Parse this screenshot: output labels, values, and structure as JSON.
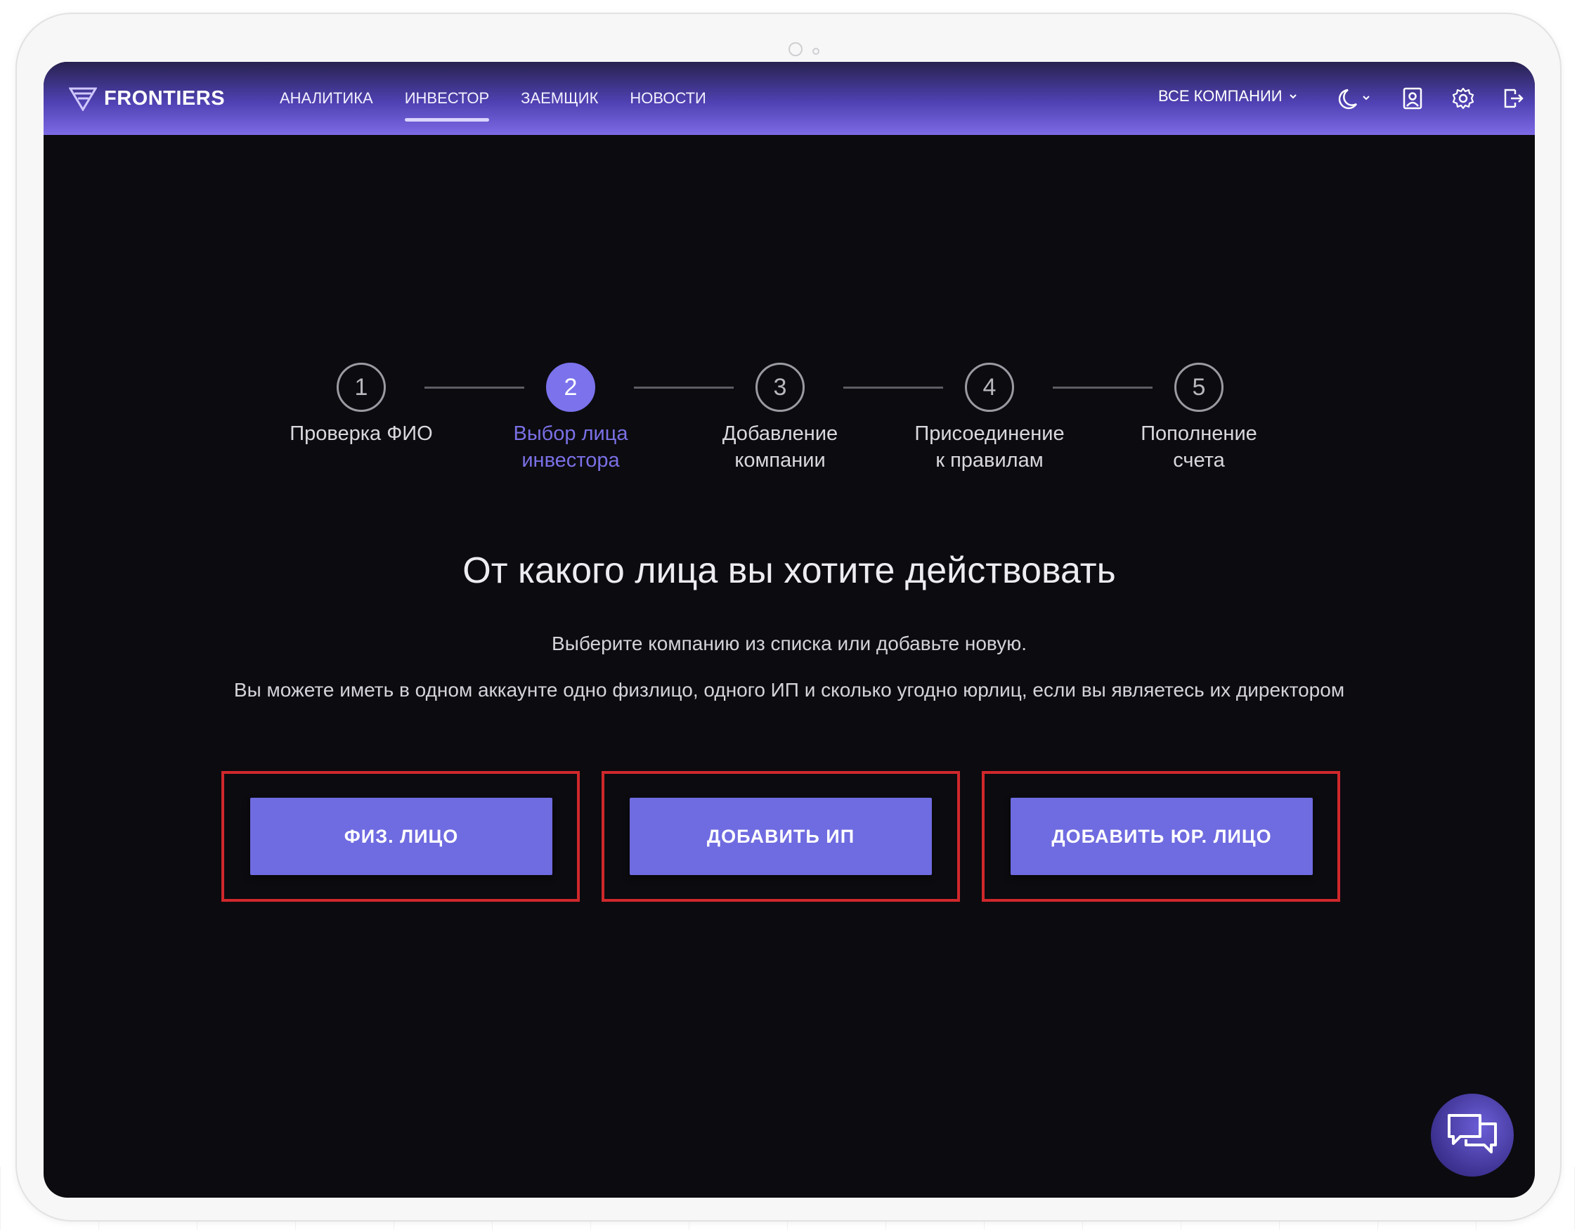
{
  "app": {
    "logo_text": "FRONTIERS"
  },
  "nav": {
    "items": [
      {
        "label": "АНАЛИТИКА",
        "active": false
      },
      {
        "label": "ИНВЕСТОР",
        "active": true
      },
      {
        "label": "ЗАЕМЩИК",
        "active": false
      },
      {
        "label": "НОВОСТИ",
        "active": false
      }
    ]
  },
  "header": {
    "company_select": "ВСЕ КОМПАНИИ",
    "icons": [
      "moon-icon",
      "user-card-icon",
      "gear-icon",
      "logout-icon"
    ]
  },
  "stepper": {
    "current_step": 2,
    "steps": [
      {
        "number": "1",
        "line1": "Проверка ФИО",
        "line2": ""
      },
      {
        "number": "2",
        "line1": "Выбор лица",
        "line2": "инвестора"
      },
      {
        "number": "3",
        "line1": "Добавление",
        "line2": "компании"
      },
      {
        "number": "4",
        "line1": "Присоединение",
        "line2": "к правилам"
      },
      {
        "number": "5",
        "line1": "Пополнение",
        "line2": "счета"
      }
    ]
  },
  "main": {
    "title": "От какого лица вы хотите действовать",
    "subtitle": "Выберите компанию из списка или добавьте новую.",
    "description": "Вы можете иметь в одном аккаунте одно физлицо, одного ИП и сколько угодно юрлиц, если вы являетесь их директором"
  },
  "actions": {
    "individual": "ФИЗ. ЛИЦО",
    "add_ip": "ДОБАВИТЬ ИП",
    "add_legal": "ДОБАВИТЬ ЮР. ЛИЦО"
  },
  "colors": {
    "accent": "#6f6be0",
    "highlight_frame": "#d0282c",
    "background": "#0c0b0f"
  }
}
